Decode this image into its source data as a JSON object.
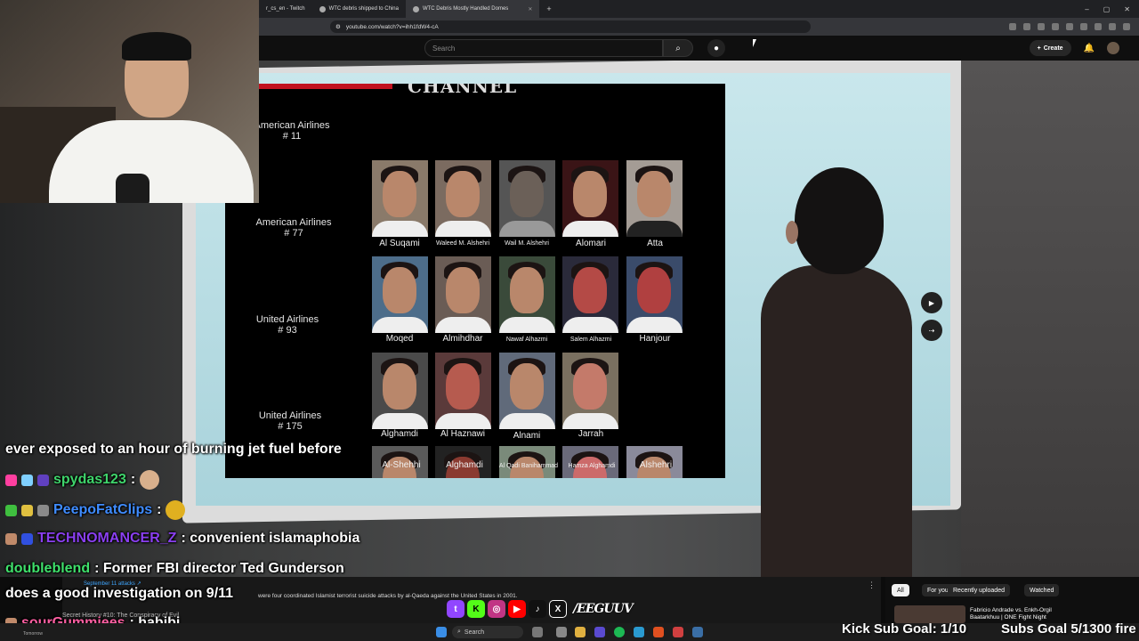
{
  "browser": {
    "tabs": [
      {
        "label": "r_cs_en - Twitch",
        "active": false
      },
      {
        "label": "WTC debris shipped to China",
        "active": false
      },
      {
        "label": "WTC Debris Mostly Handled Domes",
        "active": true
      }
    ],
    "new_tab": "+",
    "url": "youtube.com/watch?v=ihh1fdW4-cA",
    "win_min": "–",
    "win_max": "▢",
    "win_close": "✕"
  },
  "youtube": {
    "search_placeholder": "Search",
    "create_label": "Create",
    "description_tag": "September 11 attacks ↗",
    "description_text": "were four coordinated Islamist terrorist suicide attacks by al-Qaeda against the United States in 2001.",
    "description_sub": "Secret History #10: The Conspiracy of Evil",
    "chips": [
      "All",
      "For you",
      "Recently uploaded",
      "Watched"
    ],
    "rec_title": "Fabricio Andrade vs. Enkh-Orgil Baatarkhuu | ONE Fight Night"
  },
  "slide": {
    "title": "CHANNEL",
    "groups": [
      {
        "flight": "American Airlines\n# 11",
        "names": [
          "Al Suqami",
          "Waleed M. Alshehri",
          "Wail M. Alshehri",
          "Alomari",
          "Atta"
        ]
      },
      {
        "flight": "American Airlines\n# 77",
        "names": [
          "Moqed",
          "Almihdhar",
          "Nawaf Alhazmi",
          "Salem Alhazmi",
          "Hanjour"
        ]
      },
      {
        "flight": "United Airlines\n# 93",
        "names": [
          "Alghamdi",
          "Al Haznawi",
          "Alnami",
          "Jarrah"
        ]
      },
      {
        "flight": "United Airlines\n# 175",
        "names": [
          "Al-Shehhi",
          "Alghamdi",
          "Al Qadi Banihammad",
          "Hamza Alghamdi",
          "Alshehri"
        ]
      }
    ]
  },
  "chat": [
    {
      "user": "",
      "message": "ever exposed to an hour of burning jet fuel before",
      "color": "#ffffff"
    },
    {
      "user": "spydas123",
      "message": ":",
      "color": "#3fd46b"
    },
    {
      "user": "PeepoFatClips",
      "message": ":",
      "color": "#3f8cff"
    },
    {
      "user": "TECHNOMANCER_Z",
      "message": ": convenient islamaphobia",
      "color": "#8a3ff0"
    },
    {
      "user": "doubleblend",
      "message": ": Former FBI director Ted Gunderson",
      "color": "#3fe06b"
    },
    {
      "user": "",
      "message": "does a good investigation on 9/11",
      "color": "#ffffff"
    },
    {
      "user": "sourGummiees",
      "message": ": habibi",
      "color": "#ff5fa2"
    }
  ],
  "overlay": {
    "socials_handle": "/EEGUUV",
    "kick_goal": "Kick Sub Goal: 1/10",
    "subs_goal": "Subs Goal 5/1300 fire"
  },
  "taskbar": {
    "search_label": "Search",
    "time": "Tomorrow"
  },
  "colors": {
    "youtube_red": "#ff0000",
    "twitch_purple": "#9146ff",
    "kick_green": "#53fc18"
  }
}
